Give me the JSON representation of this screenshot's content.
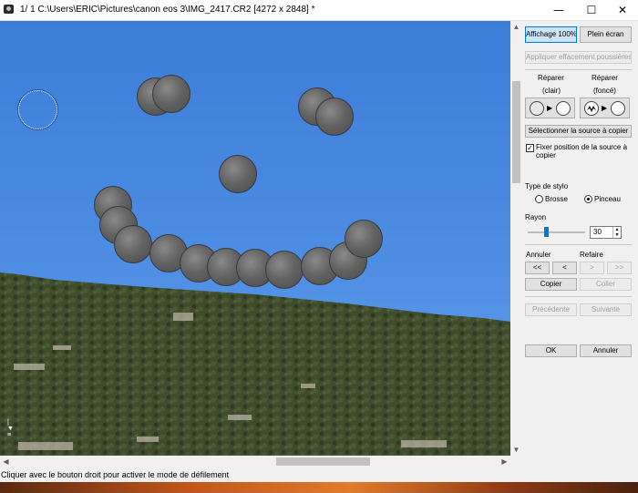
{
  "window": {
    "title": "1/  1  C:\\Users\\ERIC\\Pictures\\canon eos 3\\IMG_2417.CR2 [4272 x 2848] *",
    "minimize_glyph": "—",
    "maximize_glyph": "☐",
    "close_glyph": "✕"
  },
  "canvas": {
    "sky_color": "#4a8ae0",
    "hill_color": "#3c4a2a",
    "scale_glyph": "|\n▼\n≡"
  },
  "scrollbars": {
    "up_arrow": "▲",
    "down_arrow": "▼",
    "left_arrow": "◀",
    "right_arrow": "▶"
  },
  "panel": {
    "view_100": "Affichage 100%",
    "fullscreen": "Plein écran",
    "apply_dust": "Appliquer effacement poussières",
    "repair_light_line1": "Réparer",
    "repair_light_line2": "(clair)",
    "repair_dark_line1": "Réparer",
    "repair_dark_line2": "(foncé)",
    "select_source": "Sélectionner la source à copier",
    "fix_source_checked": true,
    "fix_source_label": "Fixer position de la source à copier",
    "stylus_type_label": "Type de stylo",
    "brush_label": "Brosse",
    "pencil_label": "Pinceau",
    "selected_stylus": "Pinceau",
    "radius_label": "Rayon",
    "radius_value": "30",
    "undo_label": "Annuler",
    "redo_label": "Refaire",
    "undo_all": "<<",
    "undo_one": "<",
    "redo_one": ">",
    "redo_all": ">>",
    "copy": "Copier",
    "paste": "Coller",
    "previous": "Précédente",
    "next": "Suivante",
    "ok": "OK",
    "cancel": "Annuler",
    "arrow_glyph": "▶"
  },
  "status": {
    "text": "Cliquer avec le bouton droit pour activer le mode de défilement"
  },
  "colors": {
    "accent": "#0078d7",
    "blob": "#5e5e5e"
  }
}
